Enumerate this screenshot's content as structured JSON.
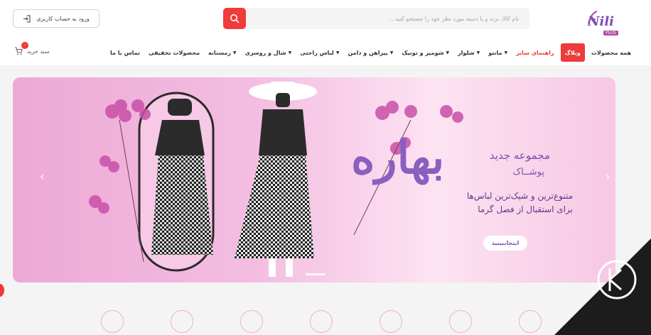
{
  "brand": {
    "name": "Nili",
    "badge": "PLUS",
    "accent": "#ef3b39",
    "purple": "#7a4fb3"
  },
  "search": {
    "placeholder": "نام کالا، برند و یا دسته مورد نظر خود را جستجو کنید..."
  },
  "header": {
    "login_label": "ورود به حساب کاربری"
  },
  "cart": {
    "label": "سبد خرید",
    "count": "۰"
  },
  "nav": {
    "items": [
      {
        "label": "همه محصولات",
        "has_chevron": false
      },
      {
        "label": "وبلاگ",
        "has_chevron": false
      },
      {
        "label": "راهنمای سایز",
        "has_chevron": false
      },
      {
        "label": "مانتو",
        "has_chevron": true
      },
      {
        "label": "شلوار",
        "has_chevron": true
      },
      {
        "label": "شومیز و تونیک",
        "has_chevron": true
      },
      {
        "label": "پیراهن و دامن",
        "has_chevron": true
      },
      {
        "label": "لباس راحتی",
        "has_chevron": true
      },
      {
        "label": "شال و روسری",
        "has_chevron": true
      },
      {
        "label": "زمستانه",
        "has_chevron": true
      },
      {
        "label": "محصولات تخفیفی",
        "has_chevron": false
      },
      {
        "label": "تماس با ما",
        "has_chevron": false
      }
    ]
  },
  "banner": {
    "calligraphy": "بهاره",
    "heading": "مجموعه جدید",
    "subheading": "پوشــاک",
    "description": "متنوع‌ترین و شیک‌ترین لباس‌ها برای استقبال از فصل گرما",
    "button_label": "اینجاببینید",
    "prev_arrow": "‹",
    "next_arrow": "›"
  }
}
